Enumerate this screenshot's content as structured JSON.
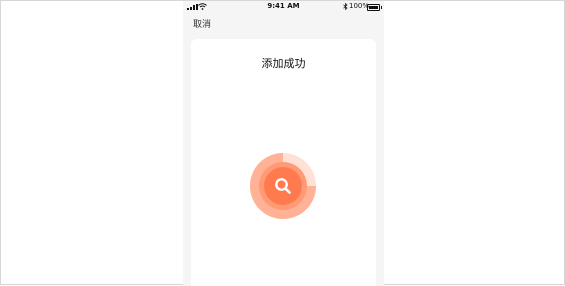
{
  "status_bar": {
    "time": "9:41 AM",
    "battery": "100%",
    "icons": [
      "signal-icon",
      "wifi-icon",
      "bluetooth-icon",
      "battery-icon"
    ]
  },
  "nav": {
    "cancel_label": "取消"
  },
  "card": {
    "title": "添加成功"
  },
  "colors": {
    "accent": "#ff7a4f",
    "accent_light": "#ffb295",
    "accent_faint": "#ffe1d6",
    "background": "#f5f5f5"
  },
  "search_indicator": {
    "icon": "search-icon"
  }
}
